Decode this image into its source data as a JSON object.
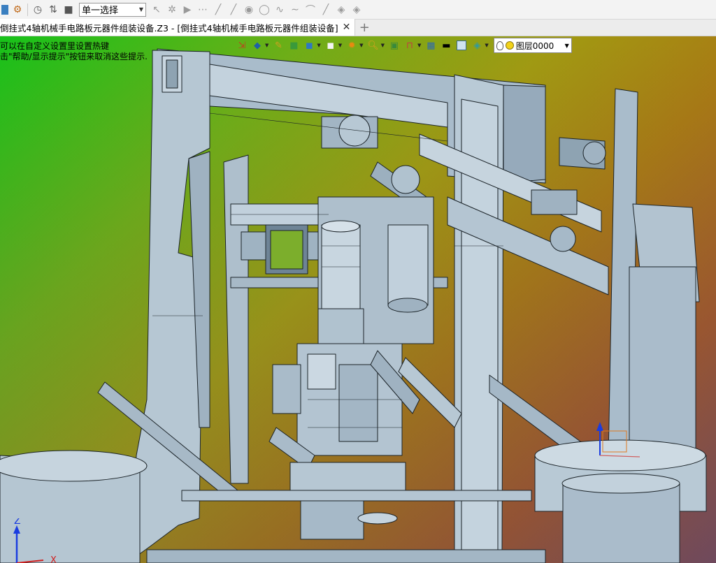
{
  "toolbar": {
    "select_value": "单一选择",
    "icons": [
      "app-icon",
      "settings-icon",
      "history-icon",
      "filter-icon",
      "stop-icon",
      "pointer-icon",
      "gear-icon",
      "play-icon",
      "point-icon",
      "line-icon",
      "line2-icon",
      "circle-icon",
      "circle2-icon",
      "curve-icon",
      "arc-icon",
      "pen-icon",
      "shape-icon",
      "shape2-icon"
    ]
  },
  "tabs": {
    "active_label": "倒挂式4轴机械手电路板元器件组装设备.Z3 - [倒挂式4轴机械手电路板元器件组装设备]",
    "close": "✕",
    "add": "+"
  },
  "hints": {
    "line1": "可以在自定义设置里设置热键",
    "line2": "击\"帮助/显示提示\"按钮来取消这些提示."
  },
  "viewport_toolbar": {
    "layer_name": "图层0000"
  },
  "axes": {
    "z_label": "Z",
    "x_label": "X"
  },
  "colors": {
    "model": "#b9cad6",
    "model_dark": "#8fa4b3",
    "edge": "#1b2328"
  }
}
